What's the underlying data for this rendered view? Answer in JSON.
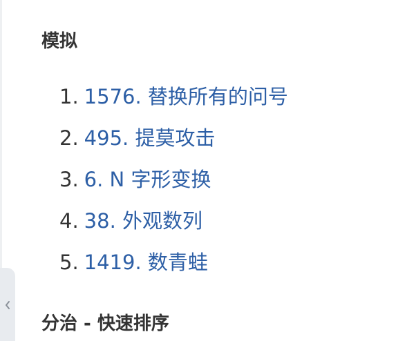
{
  "sections": [
    {
      "heading": "模拟",
      "items": [
        {
          "number": "1.",
          "label": "1576. 替换所有的问号"
        },
        {
          "number": "2.",
          "label": "495. 提莫攻击"
        },
        {
          "number": "3.",
          "label": "6. N 字形变换"
        },
        {
          "number": "4.",
          "label": "38. 外观数列"
        },
        {
          "number": "5.",
          "label": "1419. 数青蛙"
        }
      ]
    },
    {
      "heading": "分治 - 快速排序"
    }
  ],
  "sidebar_toggle": {
    "icon": "chevron-left-icon"
  },
  "colors": {
    "link": "#2d5fa6",
    "text": "#333333",
    "toggle_bg": "#e8ebef"
  }
}
